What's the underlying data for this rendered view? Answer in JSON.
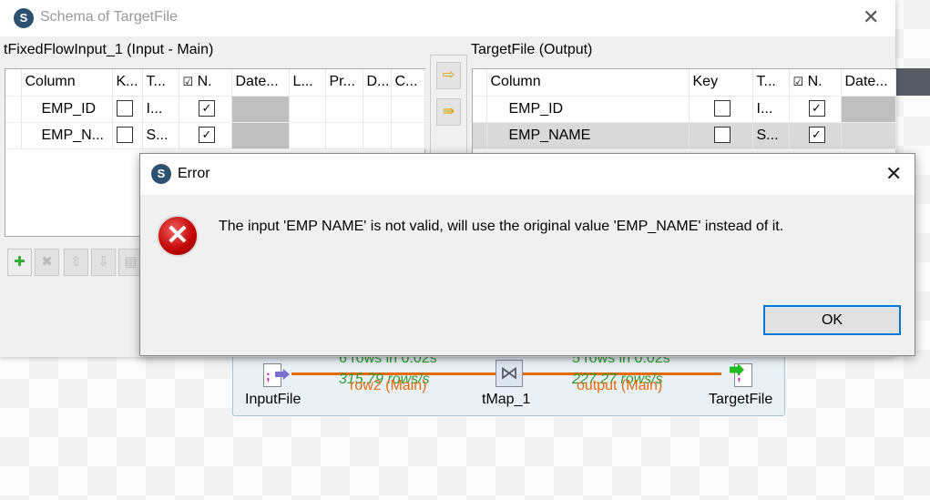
{
  "schema_dialog": {
    "title": "Schema of TargetFile",
    "input_panel": {
      "label": "tFixedFlowInput_1 (Input - Main)",
      "columns": [
        "Column",
        "K...",
        "T...",
        "N.",
        "Date...",
        "L...",
        "Pr...",
        "D...",
        "C..."
      ],
      "rows": [
        {
          "column": "EMP_ID",
          "key": false,
          "type": "I...",
          "nullable": true
        },
        {
          "column": "EMP_N...",
          "key": false,
          "type": "S...",
          "nullable": true
        }
      ]
    },
    "output_panel": {
      "label": "TargetFile (Output)",
      "columns": [
        "Column",
        "Key",
        "T...",
        "N.",
        "Date..."
      ],
      "rows": [
        {
          "column": "EMP_ID",
          "key": false,
          "type": "I...",
          "nullable": true
        },
        {
          "column": "EMP_NAME",
          "key": false,
          "type": "S...",
          "nullable": true,
          "selected": true
        }
      ]
    },
    "toolbar": [
      "add-icon",
      "remove-icon",
      "move-up-icon",
      "move-down-icon",
      "copy-icon"
    ]
  },
  "error_dialog": {
    "title": "Error",
    "message": "The input 'EMP NAME' is not valid, will use the original value 'EMP_NAME' instead of it.",
    "ok_label": "OK"
  },
  "job": {
    "components": [
      "InputFile",
      "tMap_1",
      "TargetFile"
    ],
    "links": [
      {
        "stats": "6 rows in 0.02s",
        "rate": "315.79 rows/s",
        "name": "row2 (Main)"
      },
      {
        "stats": "5 rows in 0.02s",
        "rate": "227.27 rows/s",
        "name": "output (Main)"
      }
    ]
  },
  "colors": {
    "accent": "#0078d7",
    "link": "#e46c0a",
    "stats": "#2e9b2e"
  }
}
